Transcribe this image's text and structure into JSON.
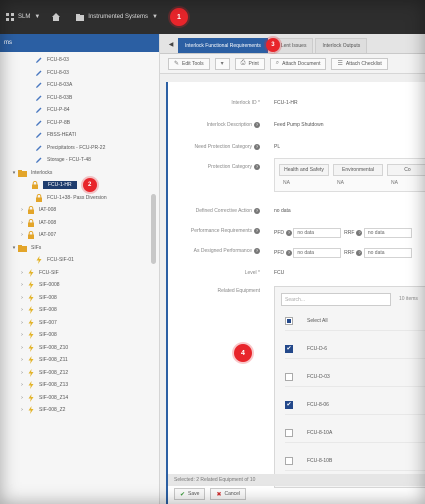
{
  "topbar": {
    "crumbs": [
      "SLM",
      "Instrumented Systems"
    ],
    "badge": "1"
  },
  "colors": {
    "accent": "#2b5fa3",
    "badge": "#e8252b",
    "topbar": "#2e2e2e"
  },
  "sidebar": {
    "header": "ms",
    "items": [
      {
        "label": "FCU-8-03",
        "icon": "pencil-icon"
      },
      {
        "label": "FCU-8-03",
        "icon": "pencil-icon"
      },
      {
        "label": "FCU-8-03A",
        "icon": "pencil-icon"
      },
      {
        "label": "FCU-8-03B",
        "icon": "pencil-icon"
      },
      {
        "label": "FCU-P-84",
        "icon": "pencil-icon"
      },
      {
        "label": "FCU-P-8B",
        "icon": "pencil-icon"
      },
      {
        "label": "FBSS-HEATI",
        "icon": "pencil-icon"
      },
      {
        "label": "Precipitators - FCU-PR-22",
        "icon": "pencil-icon"
      },
      {
        "label": "Storage - FCU-T-48",
        "icon": "pencil-icon"
      },
      {
        "label": "Interlocks",
        "icon": "folder-icon",
        "toggle": "▾"
      },
      {
        "label": "FCU-1-HR",
        "icon": "lock-icon",
        "selected": true,
        "badge": "2"
      },
      {
        "label": "FCU-1+38- Pass Diversion",
        "icon": "lock-icon"
      },
      {
        "label": "IAT-008",
        "icon": "lock-icon",
        "toggle": "›"
      },
      {
        "label": "IAT-008",
        "icon": "lock-icon",
        "toggle": "›"
      },
      {
        "label": "IAT-007",
        "icon": "lock-icon",
        "toggle": "›"
      },
      {
        "label": "SIFs",
        "icon": "folder-icon",
        "toggle": "▾"
      },
      {
        "label": "FCU-SIF-01",
        "icon": "bolt-icon"
      },
      {
        "label": "FCU-SIF",
        "icon": "bolt-icon",
        "toggle": "›"
      },
      {
        "label": "SIF-0008",
        "icon": "bolt-icon",
        "toggle": "›"
      },
      {
        "label": "SIF-008",
        "icon": "bolt-icon",
        "toggle": "›"
      },
      {
        "label": "SIF-008",
        "icon": "bolt-icon",
        "toggle": "›"
      },
      {
        "label": "SIF-007",
        "icon": "bolt-icon",
        "toggle": "›"
      },
      {
        "label": "SIF-008",
        "icon": "bolt-icon",
        "toggle": "›"
      },
      {
        "label": "SIF-008_Z10",
        "icon": "bolt-icon",
        "toggle": "›"
      },
      {
        "label": "SIF-008_Z11",
        "icon": "bolt-icon",
        "toggle": "›"
      },
      {
        "label": "SIF-008_Z12",
        "icon": "bolt-icon",
        "toggle": "›"
      },
      {
        "label": "SIF-008_Z13",
        "icon": "bolt-icon",
        "toggle": "›"
      },
      {
        "label": "SIF-008_Z14",
        "icon": "bolt-icon",
        "toggle": "›"
      },
      {
        "label": "SIF-008_Z2",
        "icon": "bolt-icon",
        "toggle": "›"
      }
    ]
  },
  "tabs": [
    {
      "label": "Interlock Functional Requirements",
      "active": true
    },
    {
      "label": "Lent Issues"
    },
    {
      "label": "Interlock Outputs"
    }
  ],
  "tab_badge": "3",
  "toolbar": {
    "edit": "Edit Tools",
    "print": "Print",
    "attach": "Attach Document",
    "checklist": "Attach Checklist"
  },
  "form": {
    "interlock_id_label": "Interlock ID *",
    "interlock_id_value": "FCU-1-HR",
    "description_label": "Interlock Description",
    "description_value": "Feed Pump Shutdown",
    "need_label": "Need Protection Category",
    "need_value": "PL",
    "protection_label": "Protection Category",
    "categories": [
      "Health and Safety",
      "Environmental",
      "Co"
    ],
    "category_values": [
      "NA",
      "NA",
      "NA"
    ],
    "defined_label": "Defined Corrective Action",
    "defined_value": "no data",
    "perf_label": "Performance Requirements",
    "perf_pfd": "PFD",
    "perf_value": "no data",
    "perf_rrf": "RRF",
    "perf_value2": "no data",
    "design_label": "As Designed Performance",
    "design_pfd": "PFD",
    "design_value": "no data",
    "design_rrf": "RRF",
    "design_value2": "no data",
    "level_label": "Level *",
    "level_value": "FCU",
    "related_label": "Related Equipment"
  },
  "equipment": {
    "search_placeholder": "Search...",
    "count": "10 items",
    "rows": [
      {
        "label": "Select All",
        "state": "part"
      },
      {
        "label": "FCU-D-6",
        "state": "on"
      },
      {
        "label": "FCU-D-03",
        "state": "off"
      },
      {
        "label": "FCU-8-06",
        "state": "on"
      },
      {
        "label": "FCU-8-10A",
        "state": "off"
      },
      {
        "label": "FCU-8-10B",
        "state": "off"
      }
    ],
    "footer": "Selected: 2 Related Equipment of 10"
  },
  "panel_badge": "4",
  "actions": {
    "save": "Save",
    "cancel": "Cancel"
  }
}
